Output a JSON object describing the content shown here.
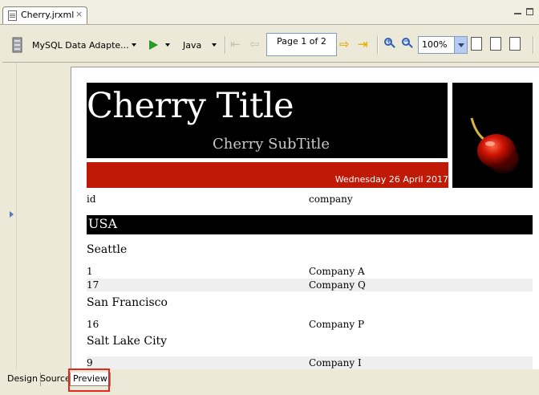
{
  "editor": {
    "tab_title": "Cherry.jrxml",
    "close_glyph": "×"
  },
  "toolbar": {
    "adapter_label": "MySQL Data Adapte...",
    "language_label": "Java",
    "page_indicator": "Page 1 of 2",
    "zoom_value": "100%"
  },
  "report": {
    "title": "Cherry Title",
    "subtitle": "Cherry SubTitle",
    "date": "Wednesday 26 April 2017",
    "column_headers": [
      "id",
      "company"
    ],
    "group": "USA",
    "cities": [
      {
        "name": "Seattle",
        "rows": [
          {
            "id": "1",
            "company": "Company A"
          },
          {
            "id": "17",
            "company": "Company Q"
          }
        ]
      },
      {
        "name": "San Francisco",
        "rows": [
          {
            "id": "16",
            "company": "Company P"
          }
        ]
      },
      {
        "name": "Salt Lake City",
        "rows": [
          {
            "id": "9",
            "company": "Company I"
          }
        ]
      }
    ]
  },
  "bottom_tabs": [
    "Design",
    "Source",
    "Preview"
  ],
  "colors": {
    "title_band": "#000000",
    "date_band": "#c01a07",
    "highlight": "#e8261b"
  }
}
